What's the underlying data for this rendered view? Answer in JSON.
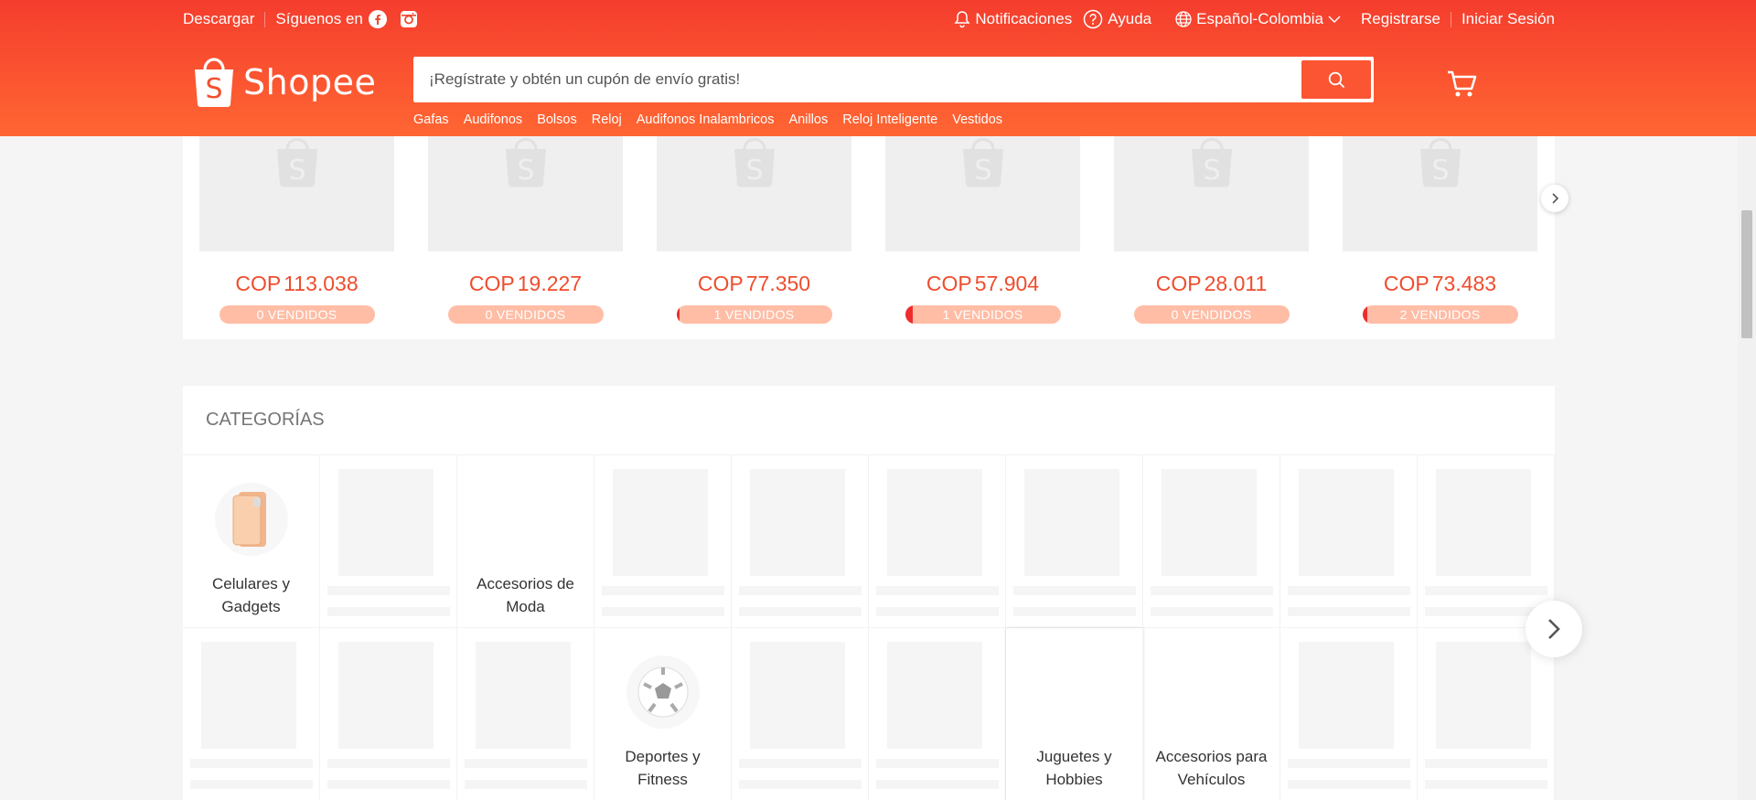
{
  "topbar": {
    "download": "Descargar",
    "follow": "Síguenos en",
    "notifications": "Notificaciones",
    "help": "Ayuda",
    "language": "Español-Colombia",
    "register": "Registrarse",
    "login": "Iniciar Sesión"
  },
  "header": {
    "logo_text": "Shopee",
    "search_placeholder": "¡Regístrate y obtén un cupón de envío gratis!",
    "keywords": [
      "Gafas",
      "Audifonos",
      "Bolsos",
      "Reloj",
      "Audifonos Inalambricos",
      "Anillos",
      "Reloj Inteligente",
      "Vestidos"
    ]
  },
  "flash_sale": {
    "currency": "COP",
    "items": [
      {
        "price": "113.038",
        "sold": "0 VENDIDOS",
        "sold_fraction": 0
      },
      {
        "price": "19.227",
        "sold": "0 VENDIDOS",
        "sold_fraction": 0
      },
      {
        "price": "77.350",
        "sold": "1 VENDIDOS",
        "sold_fraction": 0.02
      },
      {
        "price": "57.904",
        "sold": "1 VENDIDOS",
        "sold_fraction": 0.05
      },
      {
        "price": "28.011",
        "sold": "0 VENDIDOS",
        "sold_fraction": 0
      },
      {
        "price": "73.483",
        "sold": "2 VENDIDOS",
        "sold_fraction": 0.03
      }
    ]
  },
  "categories": {
    "title": "CATEGORÍAS",
    "row1": [
      "Celulares y Gadgets",
      "",
      "Accesorios de Moda",
      "",
      "",
      "",
      "",
      "",
      "",
      ""
    ],
    "row2": [
      "",
      "",
      "",
      "Deportes y Fitness",
      "",
      "",
      "Juguetes y Hobbies",
      "Accesorios para Vehículos",
      "",
      ""
    ]
  },
  "colors": {
    "brand": "#ee4d2d",
    "header_start": "#f53d2d",
    "header_end": "#ff6633"
  }
}
